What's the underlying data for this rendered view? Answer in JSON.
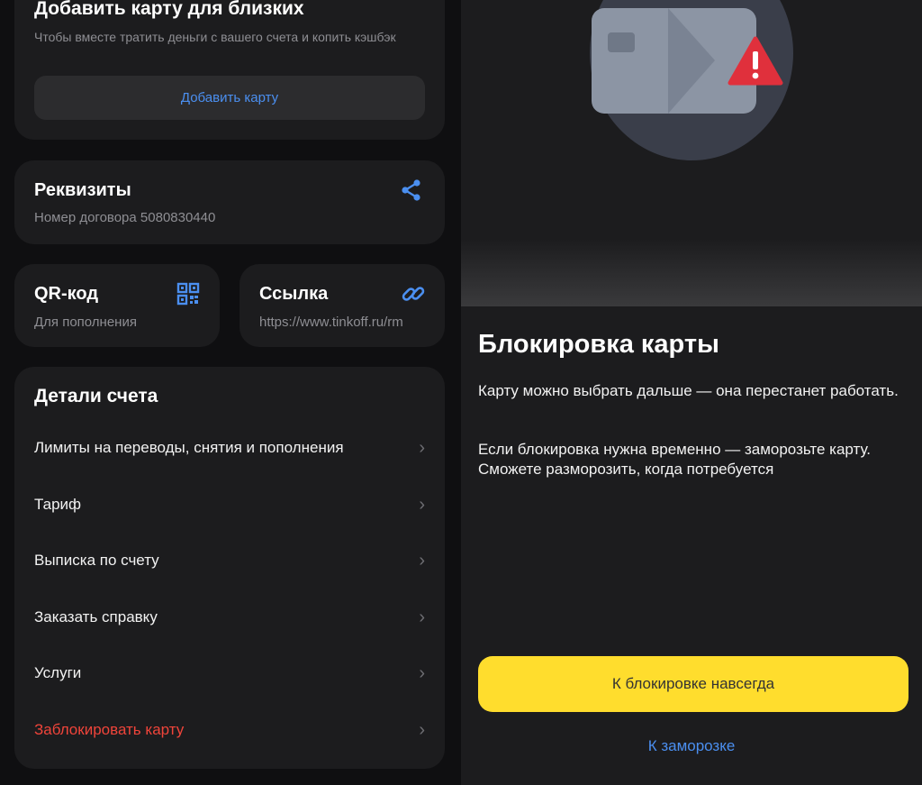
{
  "add_card": {
    "title": "Добавить карту для близких",
    "subtitle": "Чтобы вместе тратить деньги с вашего счета и копить кэшбэк",
    "button_label": "Добавить карту"
  },
  "requisites": {
    "title": "Реквизиты",
    "subtitle": "Номер договора 5080830440",
    "icon": "share-icon"
  },
  "qr": {
    "title": "QR-код",
    "subtitle": "Для пополнения",
    "icon": "qr-code-icon"
  },
  "link": {
    "title": "Ссылка",
    "subtitle": "https://www.tinkoff.ru/rm",
    "icon": "link-icon"
  },
  "details": {
    "title": "Детали счета",
    "items": [
      {
        "label": "Лимиты на переводы, снятия и пополнения"
      },
      {
        "label": "Тариф"
      },
      {
        "label": "Выписка по счету"
      },
      {
        "label": "Заказать справку"
      },
      {
        "label": "Услуги"
      },
      {
        "label": "Заблокировать карту"
      }
    ]
  },
  "block_sheet": {
    "title": "Блокировка карты",
    "paragraph1": "Карту можно выбрать дальше — она перестанет работать.",
    "paragraph2": "Если блокировка нужна временно — заморозьте карту. Сможете разморозить, когда потребуется",
    "primary_button": "К блокировке навсегда",
    "secondary_link": "К заморозке"
  },
  "colors": {
    "accent_blue": "#4b8ff0",
    "danger_red": "#f0443a",
    "primary_yellow": "#ffdd2d",
    "card_bg": "#1c1c1e"
  }
}
